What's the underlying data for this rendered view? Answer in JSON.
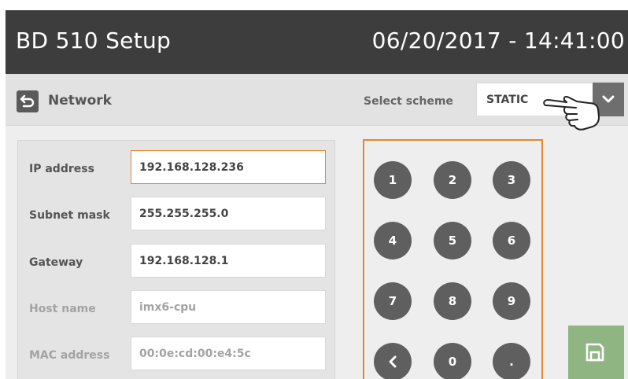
{
  "header": {
    "app_title": "BD 510 Setup",
    "datetime": "06/20/2017 - 14:41:00"
  },
  "subheader": {
    "back_icon": "back-arrow-icon",
    "page_title": "Network",
    "scheme_label": "Select scheme",
    "scheme_value": "STATIC",
    "dropdown_icon": "chevron-down-icon",
    "cursor_icon": "pointing-hand-icon"
  },
  "form": {
    "fields": [
      {
        "label": "IP address",
        "value": "192.168.128.236",
        "state": "active"
      },
      {
        "label": "Subnet mask",
        "value": "255.255.255.0",
        "state": "normal"
      },
      {
        "label": "Gateway",
        "value": "192.168.128.1",
        "state": "normal"
      },
      {
        "label": "Host name",
        "value": "imx6-cpu",
        "state": "disabled"
      },
      {
        "label": "MAC address",
        "value": "00:0e:cd:00:e4:5c",
        "state": "disabled"
      }
    ]
  },
  "keypad": {
    "keys": [
      "1",
      "2",
      "3",
      "4",
      "5",
      "6",
      "7",
      "8",
      "9",
      "",
      "0",
      "."
    ],
    "backspace_icon": "chevron-left-icon"
  },
  "actions": {
    "save_icon": "save-icon"
  },
  "colors": {
    "header_bg": "#3d3d3d",
    "accent_orange": "#e8862e",
    "key_bg": "#5f5f5f",
    "save_green": "#8fb583"
  }
}
